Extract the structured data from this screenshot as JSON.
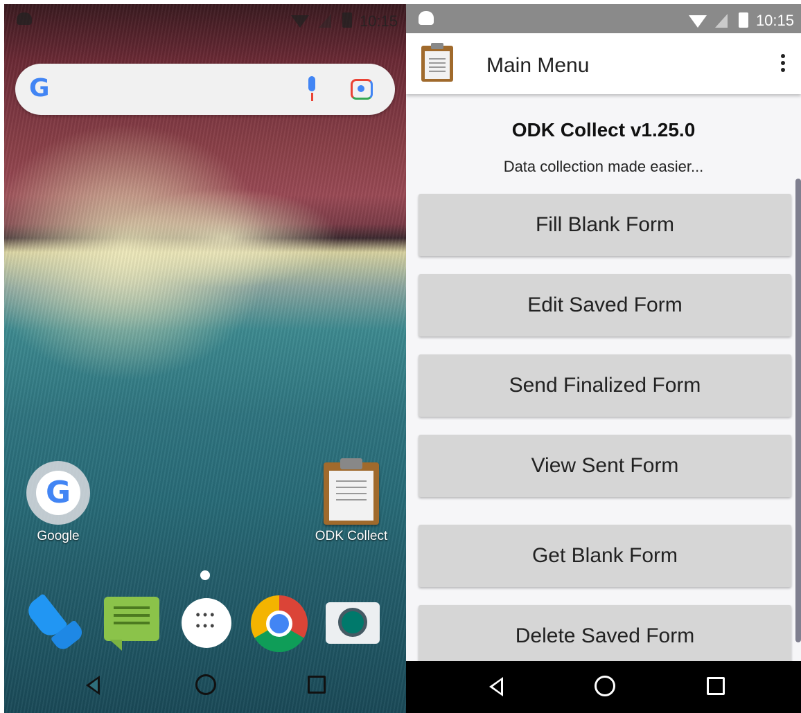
{
  "home_screen": {
    "status_bar": {
      "time": "10:15"
    },
    "search_bar": {
      "logo_letter": "G"
    },
    "shortcuts": [
      {
        "label": "Google",
        "icon": "google-icon"
      },
      {
        "label": "ODK Collect",
        "icon": "clipboard-icon"
      }
    ],
    "dock": [
      "phone-icon",
      "messages-icon",
      "app-drawer-icon",
      "chrome-icon",
      "camera-icon"
    ],
    "google_letter": "G"
  },
  "odk_app": {
    "status_bar": {
      "time": "10:15"
    },
    "app_bar": {
      "title": "Main Menu"
    },
    "app_name": "ODK Collect v1.25.0",
    "tagline": "Data collection made easier...",
    "menu": {
      "fill_blank": "Fill Blank Form",
      "edit_saved": "Edit Saved Form",
      "send_finalized": "Send Finalized Form",
      "view_sent": "View Sent Form",
      "get_blank": "Get Blank Form",
      "delete_saved": "Delete Saved Form"
    },
    "colors": {
      "button_bg": "#d6d6d6",
      "status_bar": "#8a8a8a",
      "nav_bar": "#000000"
    }
  }
}
